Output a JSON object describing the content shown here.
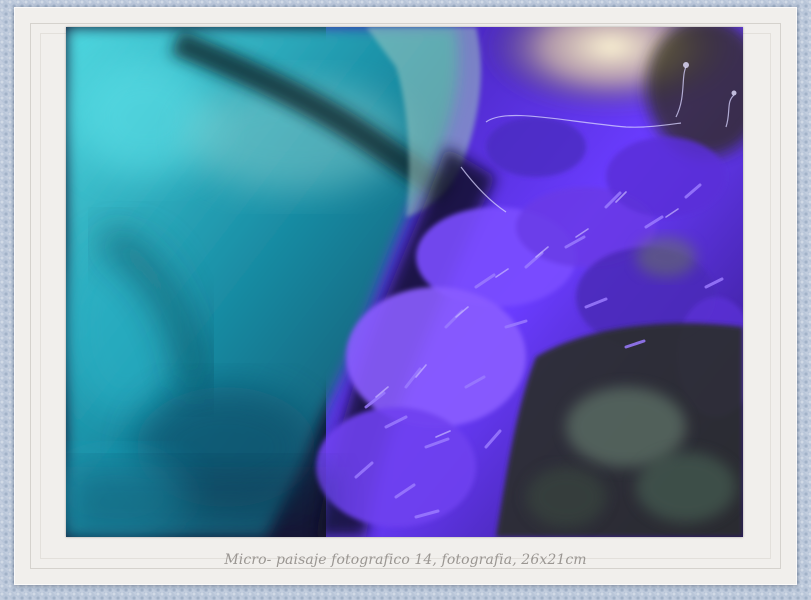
{
  "caption": "Micro- paisaje fotografico 14, fotografia, 26x21cm",
  "colors": {
    "background": "#b9c6d9",
    "frame": "#f1efec",
    "caption_text": "#9a9692",
    "photo_teal": "#1fa3b8",
    "photo_violet": "#6a3cff",
    "photo_dark": "#141026"
  }
}
